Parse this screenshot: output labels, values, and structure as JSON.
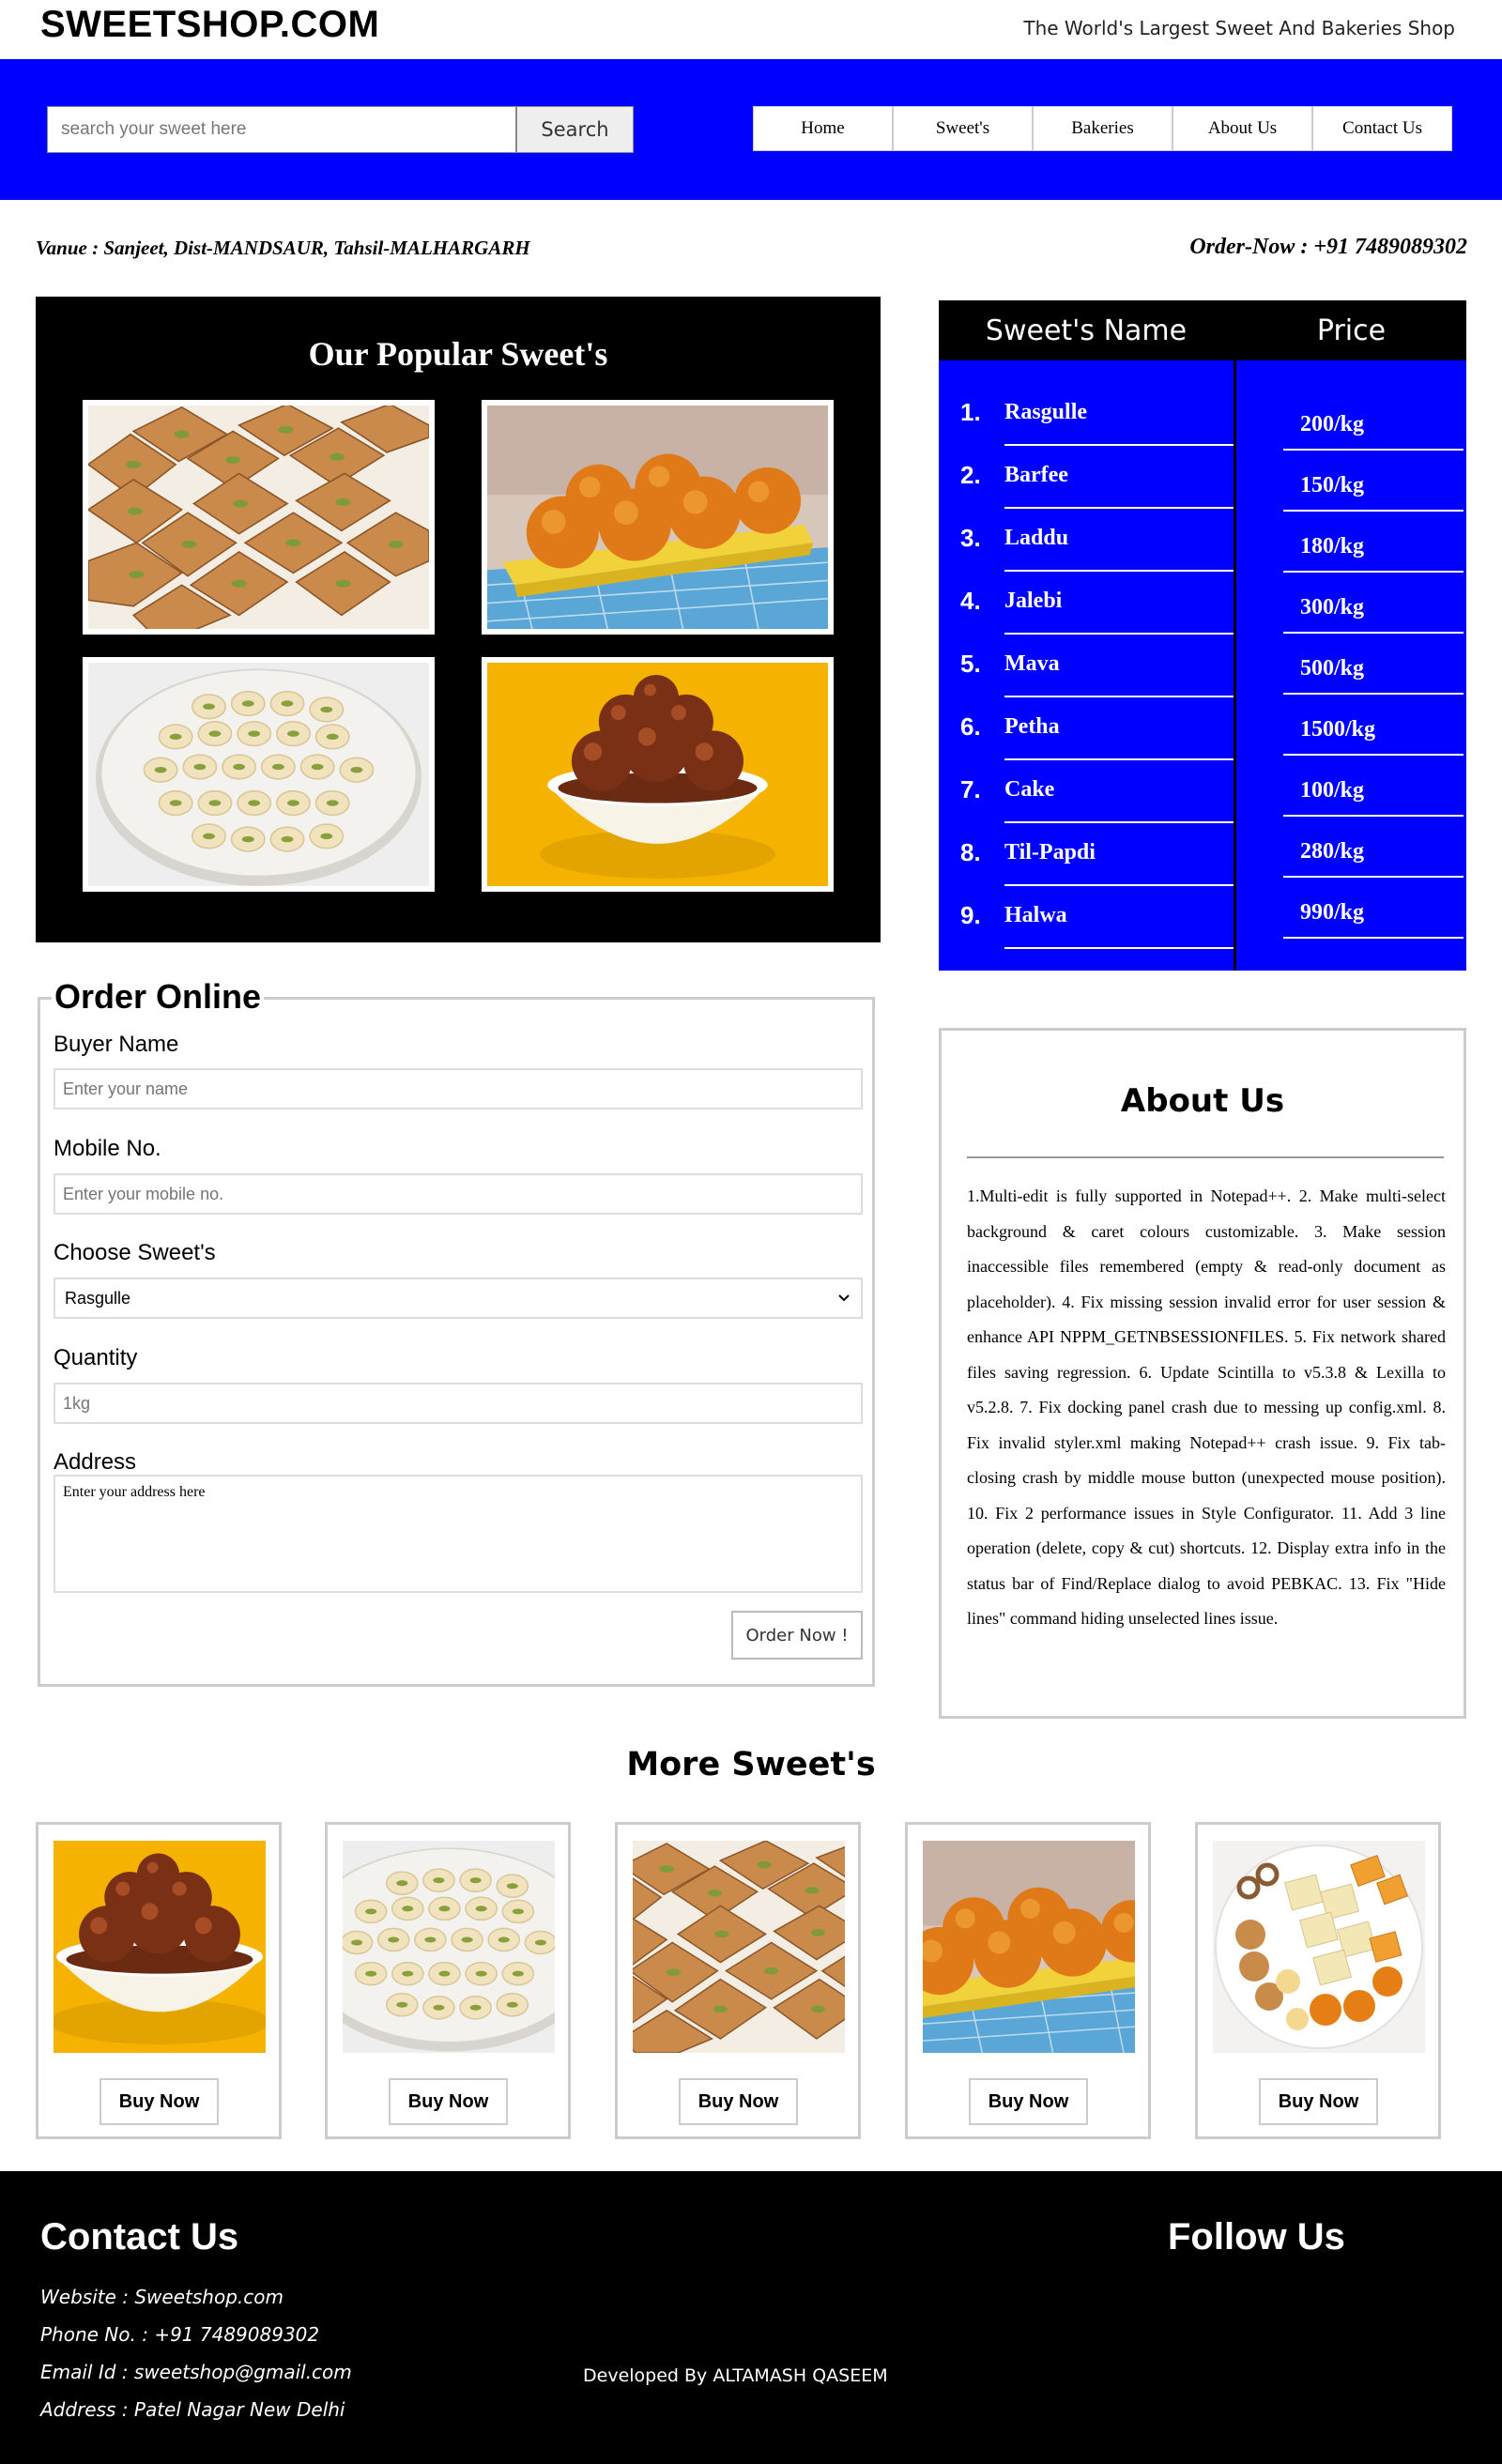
{
  "header": {
    "logo": "SWEETSHOP.COM",
    "tagline": "The World's Largest Sweet And Bakeries Shop"
  },
  "search": {
    "placeholder": "search your sweet here",
    "button_label": "Search"
  },
  "nav": {
    "items": [
      "Home",
      "Sweet's",
      "Bakeries",
      "About Us",
      "Contact Us"
    ]
  },
  "info": {
    "venue": "Vanue : Sanjeet, Dist-MANDSAUR, Tahsil-MALHARGARH",
    "order_now": "Order-Now : +91 7489089302"
  },
  "popular": {
    "title": "Our Popular Sweet's",
    "images": [
      "barfi-squares-image",
      "orange-laddu-image",
      "peda-plate-image",
      "gulab-jamun-image"
    ]
  },
  "price_table": {
    "name_header": "Sweet's Name",
    "price_header": "Price",
    "rows": [
      {
        "num": "1.",
        "name": "Rasgulle",
        "price": "200/kg"
      },
      {
        "num": "2.",
        "name": "Barfee",
        "price": "150/kg"
      },
      {
        "num": "3.",
        "name": "Laddu",
        "price": "180/kg"
      },
      {
        "num": "4.",
        "name": "Jalebi",
        "price": "300/kg"
      },
      {
        "num": "5.",
        "name": "Mava",
        "price": "500/kg"
      },
      {
        "num": "6.",
        "name": "Petha",
        "price": "1500/kg"
      },
      {
        "num": "7.",
        "name": "Cake",
        "price": "100/kg"
      },
      {
        "num": "8.",
        "name": "Til-Papdi",
        "price": "280/kg"
      },
      {
        "num": "9.",
        "name": "Halwa",
        "price": "990/kg"
      }
    ]
  },
  "order_form": {
    "legend": "Order Online",
    "buyer_label": "Buyer Name",
    "buyer_placeholder": "Enter your name",
    "mobile_label": "Mobile No.",
    "mobile_placeholder": "Enter your mobile no.",
    "sweet_label": "Choose Sweet's",
    "sweet_selected": "Rasgulle",
    "quantity_label": "Quantity",
    "quantity_placeholder": "1kg",
    "address_label": "Address",
    "address_placeholder": "Enter your address here",
    "submit_label": "Order Now !"
  },
  "about": {
    "title": "About Us",
    "text": "1.Multi-edit is fully supported in Notepad++. 2. Make multi-select background & caret colours customizable. 3. Make session inaccessible files remembered (empty & read-only document as placeholder). 4. Fix missing session invalid error for user session & enhance API NPPM_GETNBSESSIONFILES. 5. Fix network shared files saving regression. 6. Update Scintilla to v5.3.8 & Lexilla to v5.2.8. 7. Fix docking panel crash due to messing up config.xml. 8. Fix invalid styler.xml making Notepad++ crash issue. 9. Fix tab-closing crash by middle mouse button (unexpected mouse position). 10. Fix 2 performance issues in Style Configurator. 11. Add 3 line operation (delete, copy & cut) shortcuts. 12. Display extra info in the status bar of Find/Replace dialog to avoid PEBKAC. 13. Fix \"Hide lines\" command hiding unselected lines issue."
  },
  "more": {
    "title": "More Sweet's",
    "buy_label": "Buy Now",
    "cards": [
      "gulab-jamun-image",
      "peda-plate-image",
      "barfi-squares-image",
      "orange-laddu-image",
      "mixed-sweets-image"
    ]
  },
  "footer": {
    "contact_title": "Contact Us",
    "follow_title": "Follow Us",
    "website": "Website : Sweetshop.com",
    "phone": "Phone No. : +91 7489089302",
    "email": "Email Id : sweetshop@gmail.com",
    "address": "Address : Patel Nagar New Delhi",
    "developer": "Developed By ALTAMASH QASEEM"
  },
  "colors": {
    "brand_blue": "#0000ff",
    "black": "#000000",
    "white": "#ffffff"
  }
}
